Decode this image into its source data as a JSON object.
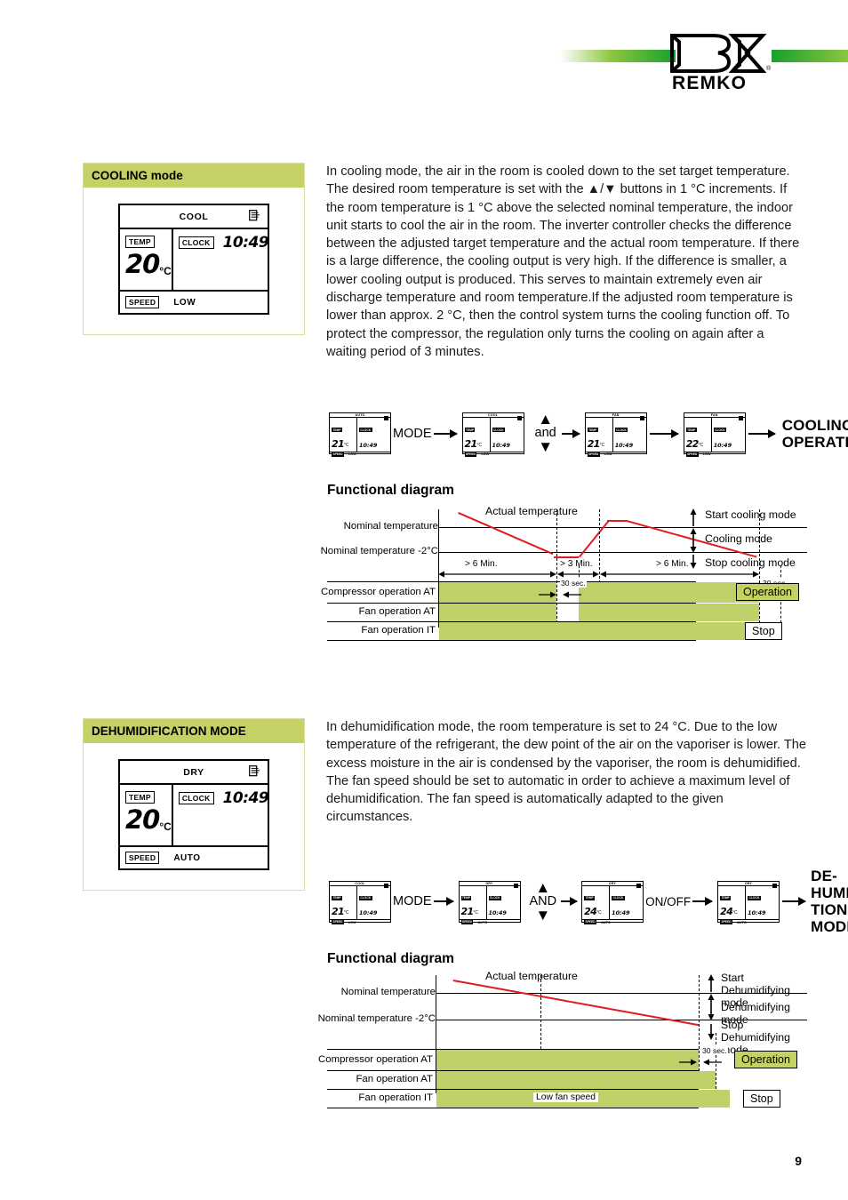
{
  "brand": {
    "name": "REMKO",
    "registered": "®"
  },
  "page": {
    "number": "9"
  },
  "cooling": {
    "panel_title": "COOLING mode",
    "display": {
      "mode": "COOL",
      "temp_tag": "TEMP",
      "temp_value": "20",
      "temp_unit": "°C",
      "clock_tag": "CLOCK",
      "clock_value": "10:49",
      "speed_tag": "SPEED",
      "speed_value": "LOW",
      "icon": "airflow-icon"
    },
    "text": "In cooling mode, the air in the room is cooled down to the set target temperature. The desired room temperature is set with the ▲/▼ buttons in 1 °C increments. If the room temperature is 1 °C above the selected nominal temperature, the indoor unit starts to cool the air in the room. The inverter controller checks the difference between the adjusted target temperature and the actual room temperature. If there is a large difference, the cooling output is very high. If the difference is smaller, a lower cooling output is produced. This serves to maintain extremely even air discharge temperature and room temperature.If the adjusted room temperature is lower than approx. 2 °C, then the control system turns the cooling function off. To protect the compressor, the regulation only turns the cooling on again after a waiting period of 3 minutes.",
    "flow": {
      "steps": [
        {
          "mode": "AUTO",
          "temp": "21",
          "unit": "°C",
          "clock": "10:49",
          "speed": "LOW",
          "temp_tag": "TEMP",
          "clock_tag": "CLOCK",
          "speed_tag": "SPEED"
        },
        {
          "mode": "COOL",
          "temp": "21",
          "unit": "°C",
          "clock": "10:49",
          "speed": "LOW",
          "temp_tag": "TEMP",
          "clock_tag": "CLOCK",
          "speed_tag": "SPEED"
        },
        {
          "mode": "FAN",
          "temp": "21",
          "unit": "°C",
          "clock": "10:49",
          "speed": "LOW",
          "temp_tag": "TEMP",
          "clock_tag": "CLOCK",
          "speed_tag": "SPEED"
        },
        {
          "mode": "FAN",
          "temp": "22",
          "unit": "°C",
          "clock": "10:49",
          "speed": "LOW",
          "temp_tag": "TEMP",
          "clock_tag": "CLOCK",
          "speed_tag": "SPEED"
        }
      ],
      "action1": "MODE",
      "action2": "and",
      "up": "▲",
      "down": "▼",
      "result_line1": "COOLING",
      "result_line2": "OPERATION"
    },
    "diagram": {
      "title": "Functional diagram",
      "curve_label": "Actual temperature",
      "y_labels": [
        "Nominal temperature",
        "Nominal temperature -2°C"
      ],
      "row_labels": [
        "Compressor operation AT",
        "Fan operation AT",
        "Fan operation IT"
      ],
      "time_marks": [
        "> 6 Min.",
        "> 3 Min.",
        "> 6 Min."
      ],
      "sec_marks": [
        "30 sec.",
        "30 sec."
      ],
      "annotations": [
        "Start cooling mode",
        "Cooling mode",
        "Stop cooling mode"
      ],
      "legend": [
        "Operation",
        "Stop"
      ]
    }
  },
  "dehumidification": {
    "panel_title": "DEHUMIDIFICATION MODE",
    "display": {
      "mode": "DRY",
      "temp_tag": "TEMP",
      "temp_value": "20",
      "temp_unit": "°C",
      "clock_tag": "CLOCK",
      "clock_value": "10:49",
      "speed_tag": "SPEED",
      "speed_value": "AUTO",
      "icon": "airflow-icon"
    },
    "text": "In dehumidification mode, the room temperature is set to 24 °C. Due to the low temperature of the refrigerant, the dew point of the air on the vaporiser is lower. The excess moisture in the air is condensed by the vaporiser, the room is dehumidified. The fan speed should be set to automatic in order to achieve a maximum level of dehumidification. The fan speed is automatically adapted to the given circumstances.",
    "flow": {
      "steps": [
        {
          "mode": "COOL",
          "temp": "21",
          "unit": "°C",
          "clock": "10:49",
          "speed": "LOW",
          "temp_tag": "TEMP",
          "clock_tag": "CLOCK",
          "speed_tag": "SPEED"
        },
        {
          "mode": "DRY",
          "temp": "21",
          "unit": "°C",
          "clock": "10:49",
          "speed": "AUTO",
          "temp_tag": "TEMP",
          "clock_tag": "CLOCK",
          "speed_tag": "SPEED"
        },
        {
          "mode": "DRY",
          "temp": "24",
          "unit": "°C",
          "clock": "10:49",
          "speed": "AUTO",
          "temp_tag": "TEMP",
          "clock_tag": "CLOCK",
          "speed_tag": "SPEED"
        },
        {
          "mode": "DRY",
          "temp": "24",
          "unit": "°C",
          "clock": "10:49",
          "speed": "AUTO",
          "temp_tag": "TEMP",
          "clock_tag": "CLOCK",
          "speed_tag": "SPEED"
        }
      ],
      "action1": "MODE",
      "action2": "AND",
      "action3": "ON/OFF",
      "up": "▲",
      "down": "▼",
      "result_line1": "DE-",
      "result_line2": "HUMIDIFICA-",
      "result_line3": "TION-",
      "result_line4": "MODE"
    },
    "diagram": {
      "title": "Functional diagram",
      "curve_label": "Actual temperature",
      "y_labels": [
        "Nominal temperature",
        "Nominal temperature -2°C"
      ],
      "row_labels": [
        "Compressor operation AT",
        "Fan operation AT",
        "Fan operation IT"
      ],
      "sec_marks": [
        "30 sec."
      ],
      "bar_note": "Low fan speed",
      "annotations": [
        {
          "l1": "Start",
          "l2": "Dehumidifying mode"
        },
        {
          "l1": "",
          "l2": "Dehumidifying mode"
        },
        {
          "l1": "Stop",
          "l2": "Dehumidifying mode"
        }
      ],
      "legend": [
        "Operation",
        "Stop"
      ]
    }
  },
  "chart_data": [
    {
      "type": "line",
      "title": "Functional diagram — Cooling",
      "xlabel": "",
      "ylabel": "Temperature",
      "series": [
        {
          "name": "Actual temperature",
          "points": [
            {
              "x": 0,
              "y": 1.12
            },
            {
              "x": 0.3,
              "y": 0.02
            },
            {
              "x": 0.355,
              "y": -0.02
            },
            {
              "x": 0.4,
              "y": -0.02
            },
            {
              "x": 0.545,
              "y": 1.3
            },
            {
              "x": 0.595,
              "y": 1.3
            },
            {
              "x": 1.0,
              "y": -0.08
            }
          ]
        }
      ],
      "ylim": [
        -0.4,
        1.5
      ],
      "y_reference_lines": [
        {
          "label": "Nominal temperature",
          "value": 1.0
        },
        {
          "label": "Nominal temperature -2°C",
          "value": 0.0
        }
      ],
      "time_segments": [
        "> 6 Min.",
        "> 3 Min.",
        "> 6 Min."
      ],
      "delay_marks": [
        "30 sec.",
        "30 sec."
      ],
      "timelines": [
        {
          "name": "Compressor operation AT",
          "on_segments": [
            [
              0.0,
              0.3
            ],
            [
              0.4,
              0.875
            ]
          ]
        },
        {
          "name": "Fan operation AT",
          "on_segments": [
            [
              0.0,
              0.3
            ],
            [
              0.4,
              0.875
            ]
          ]
        },
        {
          "name": "Fan operation IT",
          "on_segments": [
            [
              0.0,
              1.0
            ]
          ]
        }
      ],
      "legend": [
        "Operation",
        "Stop"
      ],
      "grid": false
    },
    {
      "type": "line",
      "title": "Functional diagram — Dehumidification",
      "xlabel": "",
      "ylabel": "Temperature",
      "series": [
        {
          "name": "Actual temperature",
          "points": [
            {
              "x": 0,
              "y": 1.35
            },
            {
              "x": 0.875,
              "y": -0.05
            }
          ]
        }
      ],
      "ylim": [
        -0.4,
        1.5
      ],
      "y_reference_lines": [
        {
          "label": "Nominal temperature",
          "value": 1.0
        },
        {
          "label": "Nominal temperature -2°C",
          "value": 0.0
        }
      ],
      "delay_marks": [
        "30 sec."
      ],
      "timelines": [
        {
          "name": "Compressor operation AT",
          "on_segments": [
            [
              0.0,
              0.84
            ]
          ]
        },
        {
          "name": "Fan operation AT",
          "on_segments": [
            [
              0.0,
              0.855
            ]
          ]
        },
        {
          "name": "Fan operation IT",
          "on_segments": [
            [
              0.0,
              1.0
            ]
          ],
          "note": "Low fan speed"
        }
      ],
      "legend": [
        "Operation",
        "Stop"
      ],
      "grid": false
    }
  ]
}
